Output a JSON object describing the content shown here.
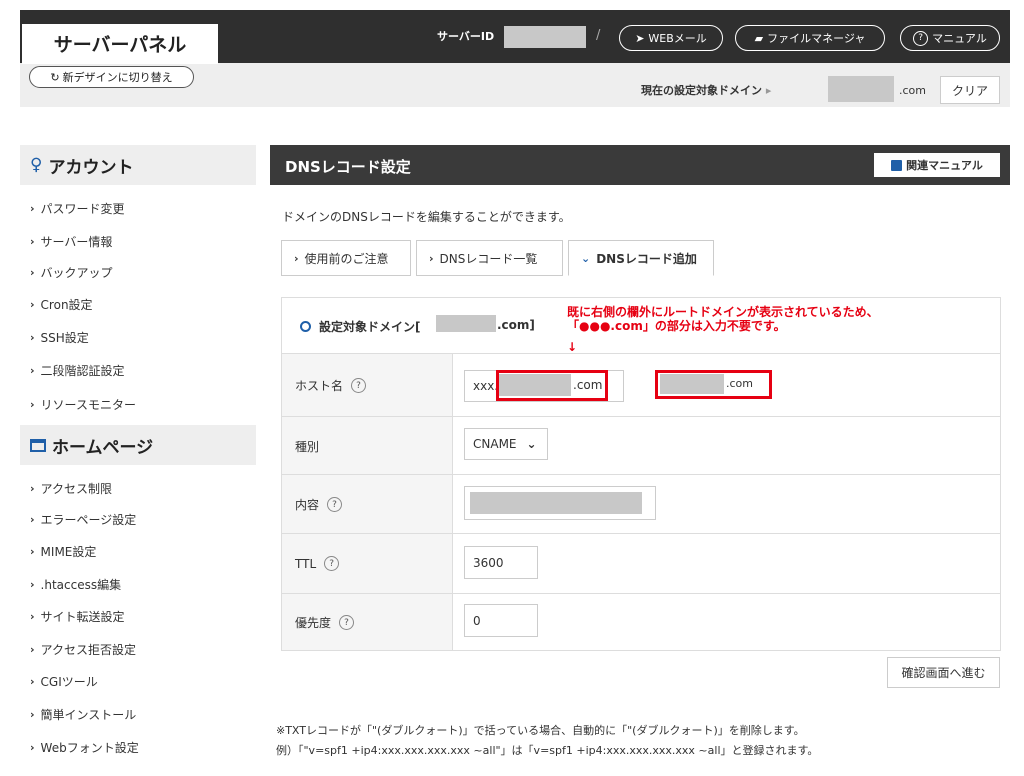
{
  "header": {
    "logo": "サーバーパネル",
    "switch_design": "新デザインに切り替え",
    "server_id_label": "サーバーID",
    "slash": "/",
    "webmail": "WEBメール",
    "file_manager": "ファイルマネージャ",
    "manual": "マニュアル",
    "target_domain_label": "現在の設定対象ドメイン",
    "target_domain_suffix": ".com",
    "clear": "クリア"
  },
  "sidebar": {
    "sections": [
      {
        "title": "アカウント",
        "items": [
          "パスワード変更",
          "サーバー情報",
          "バックアップ",
          "Cron設定",
          "SSH設定",
          "二段階認証設定",
          "リソースモニター"
        ]
      },
      {
        "title": "ホームページ",
        "items": [
          "アクセス制限",
          "エラーページ設定",
          "MIME設定",
          ".htaccess編集",
          "サイト転送設定",
          "アクセス拒否設定",
          "CGIツール",
          "簡単インストール",
          "Webフォント設定"
        ]
      }
    ]
  },
  "main": {
    "title": "DNSレコード設定",
    "related_manual": "関連マニュアル",
    "description": "ドメインのDNSレコードを編集することができます。",
    "tabs": [
      {
        "label": "使用前のご注意",
        "active": false
      },
      {
        "label": "DNSレコード一覧",
        "active": false
      },
      {
        "label": "DNSレコード追加",
        "active": true
      }
    ],
    "form": {
      "domain_label_prefix": "設定対象ドメイン[",
      "domain_label_suffix": ".com]",
      "note_line1": "既に右側の欄外にルートドメインが表示されているため、",
      "note_line2": "「●●●.com」の部分は入力不要です。",
      "note_arrow": "↓",
      "host_label": "ホスト名",
      "host_value_prefix": "xxx.",
      "host_value_suffix": ".com",
      "host_outside_suffix": ".com",
      "type_label": "種別",
      "type_value": "CNAME",
      "content_label": "内容",
      "ttl_label": "TTL",
      "ttl_value": "3600",
      "priority_label": "優先度",
      "priority_value": "0",
      "help_symbol": "?",
      "confirm": "確認画面へ進む"
    },
    "footnote_1": "※TXTレコードが「\"(ダブルクォート)」で括っている場合、自動的に「\"(ダブルクォート)」を削除します。",
    "footnote_2": "例）「\"v=spf1 +ip4:xxx.xxx.xxx.xxx ~all\"」は「v=spf1 +ip4:xxx.xxx.xxx.xxx ~all」と登録されます。"
  },
  "colors": {
    "header_bg": "#2f2f2f",
    "accent_red": "#e60012",
    "accent_blue": "#1f5fa8",
    "panel_gray": "#eeeeee"
  }
}
